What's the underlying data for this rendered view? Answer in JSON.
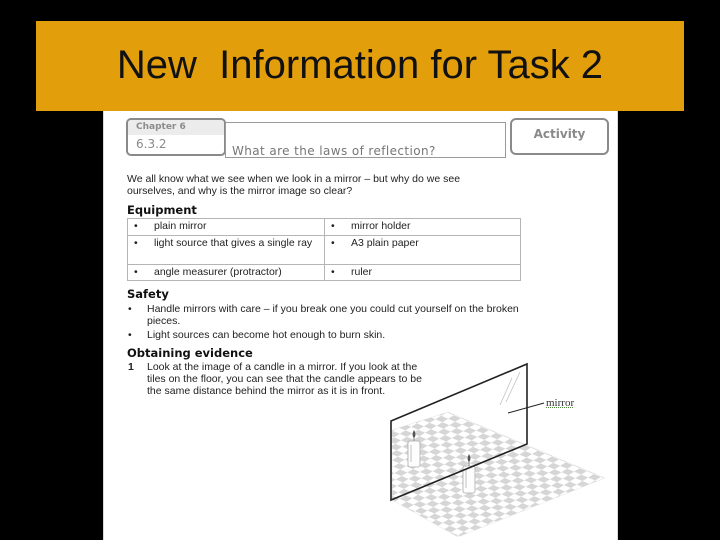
{
  "slide": {
    "title": "New  Information for Task 2",
    "banner_color": "#e39e0c",
    "background_color": "#000000"
  },
  "worksheet": {
    "chapter_label": "Chapter 6",
    "section_number": "6.3.2",
    "heading": "What are the laws of reflection?",
    "badge": "Activity",
    "intro_lines": [
      "We all know what we see when we look in a mirror – but why do we see",
      "ourselves, and why is the mirror image so clear?"
    ],
    "equipment": {
      "heading": "Equipment",
      "bullet": "•",
      "rows": [
        [
          "plain mirror",
          "mirror holder"
        ],
        [
          "light source that gives a single ray",
          "A3 plain paper"
        ],
        [
          "angle measurer (protractor)",
          "ruler"
        ]
      ]
    },
    "safety": {
      "heading": "Safety",
      "bullet": "•",
      "items": [
        "Handle mirrors with care – if you break one you could cut yourself on the broken pieces.",
        "Light sources can become hot enough to burn skin."
      ]
    },
    "obtaining_evidence": {
      "heading": "Obtaining evidence",
      "steps": [
        {
          "number": "1",
          "text": "Look at the image of a candle in a mirror. If you look at the tiles on the floor, you can see that the candle appears to be the same distance behind the mirror as it is in front."
        }
      ]
    },
    "figure": {
      "label": "mirror",
      "description": "Candle in front of a vertical plane mirror on a checkered tiled floor, with its image behind the mirror"
    }
  }
}
